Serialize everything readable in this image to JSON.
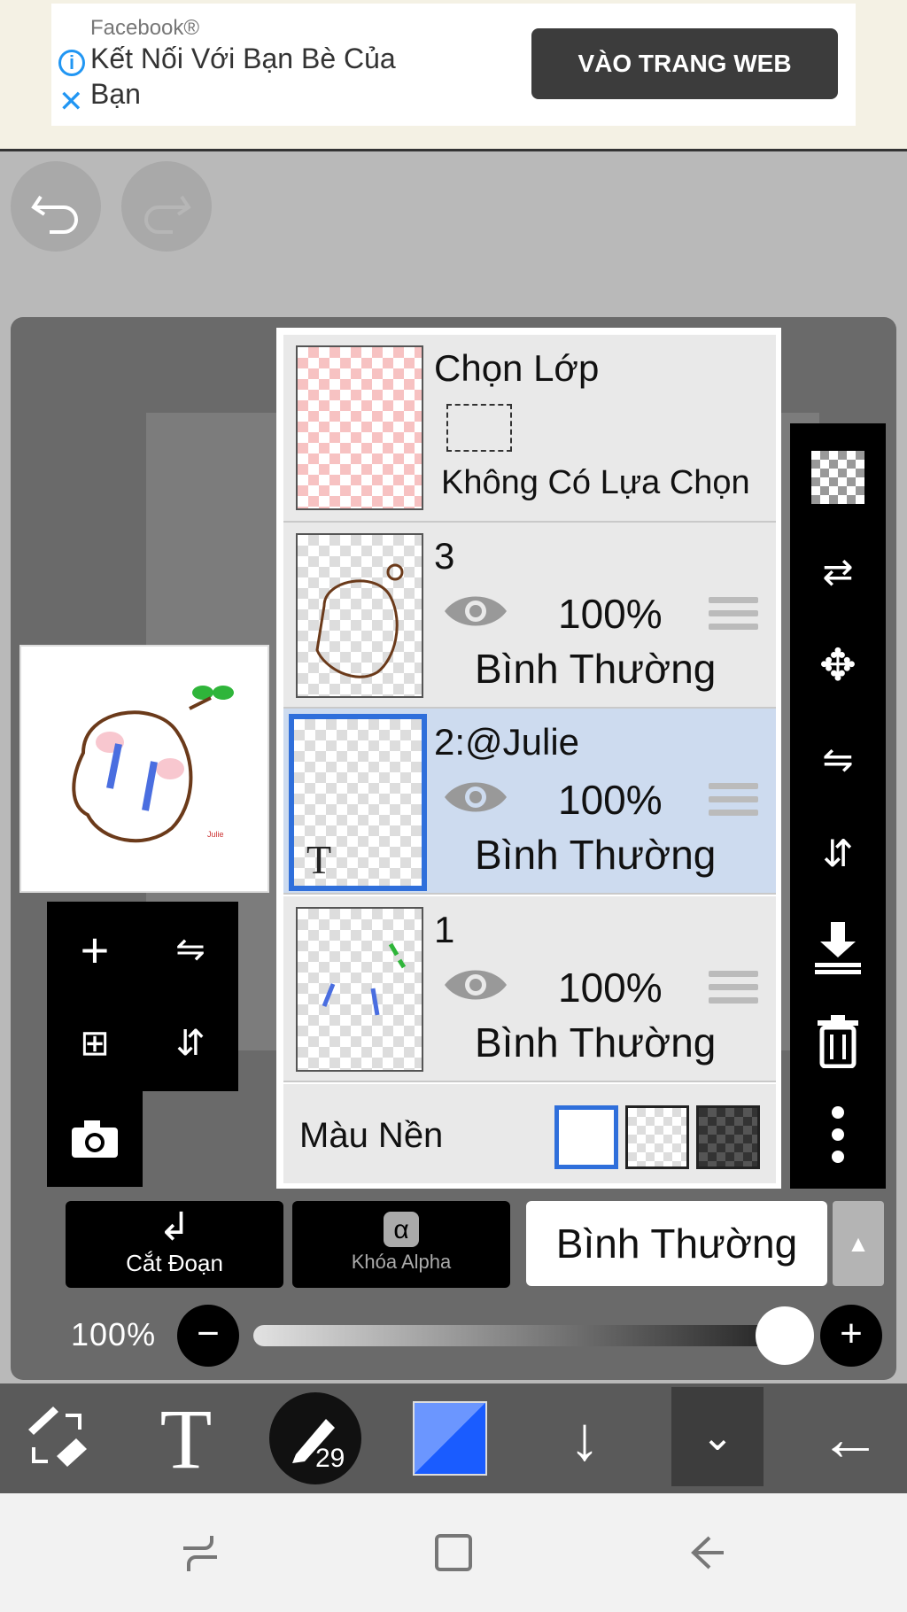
{
  "ad": {
    "brand": "Facebook®",
    "title": "Kết Nối Với Bạn Bè Của Bạn",
    "button": "VÀO TRANG WEB",
    "info_icon": "i",
    "close_icon": "✕"
  },
  "top_controls": {
    "undo_icon": "undo-icon",
    "redo_icon": "redo-icon"
  },
  "layers": {
    "selection": {
      "title": "Chọn Lớp",
      "status": "Không Có Lựa Chọn"
    },
    "items": [
      {
        "name": "3",
        "opacity": "100%",
        "blend": "Bình Thường",
        "selected": false
      },
      {
        "name": "2:@Julie",
        "opacity": "100%",
        "blend": "Bình Thường",
        "selected": true,
        "text_marker": "T"
      },
      {
        "name": "1",
        "opacity": "100%",
        "blend": "Bình Thường",
        "selected": false
      }
    ],
    "background_label": "Màu Nền"
  },
  "bottom_controls": {
    "clip_label": "Cắt Đoạn",
    "alpha_label": "Khóa Alpha",
    "alpha_symbol": "α",
    "blend_mode": "Bình Thường",
    "opacity_label": "100%",
    "opacity_value": 1.0
  },
  "toolbar": {
    "brush_size": "29",
    "text_tool": "T",
    "color": "#1a5cff"
  },
  "colors": {
    "accent": "#2f6fdb",
    "selected_layer": "#cddbef"
  }
}
